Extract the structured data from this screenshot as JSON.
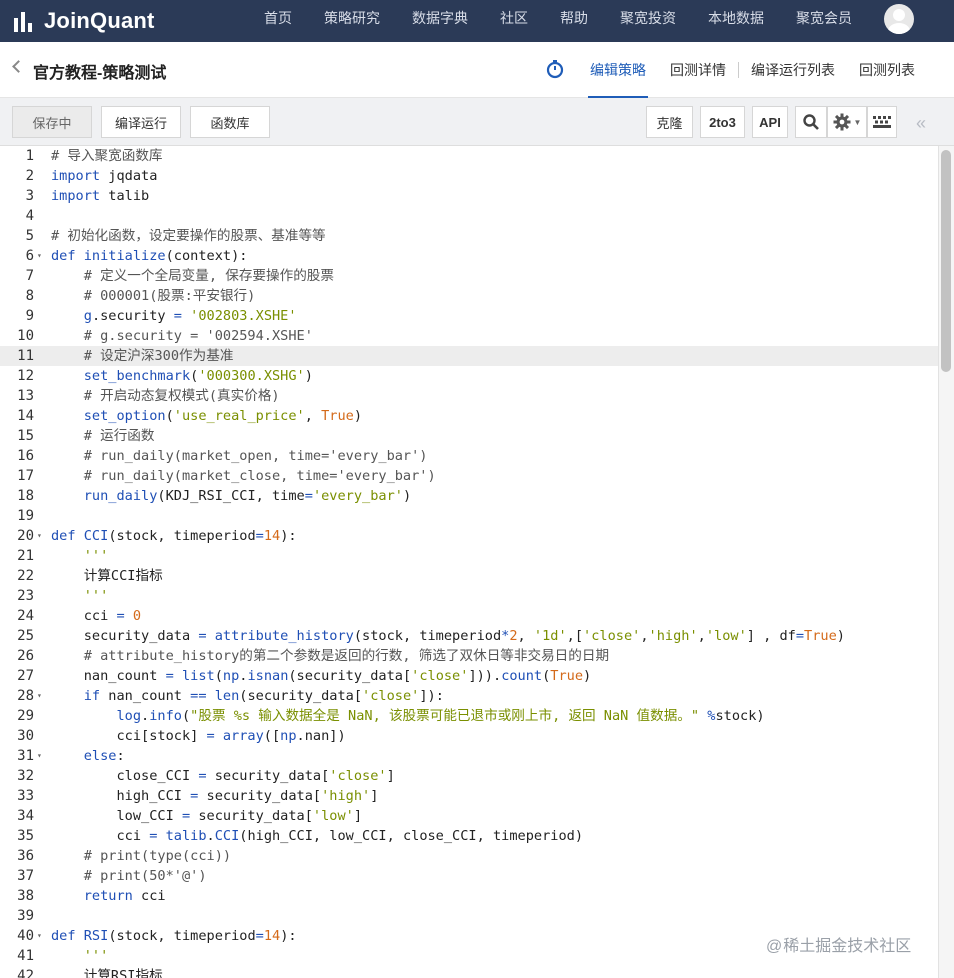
{
  "brand": {
    "name": "JoinQuant"
  },
  "nav": [
    "首页",
    "策略研究",
    "数据字典",
    "社区",
    "帮助",
    "聚宽投资",
    "本地数据",
    "聚宽会员"
  ],
  "titlebar": {
    "title": "官方教程-策略测试",
    "tabs": [
      "编辑策略",
      "回测详情",
      "编译运行列表",
      "回测列表"
    ]
  },
  "toolbar": {
    "save": "保存中",
    "compile": "编译运行",
    "library": "函数库",
    "clone": "克隆",
    "two_to_three": "2to3",
    "api": "API"
  },
  "editor": {
    "active_line": 11,
    "lines": [
      "# 导入聚宽函数库",
      "import jqdata",
      "import talib",
      "",
      "# 初始化函数，设定要操作的股票、基准等等",
      "def initialize(context):",
      "    # 定义一个全局变量, 保存要操作的股票",
      "    # 000001(股票:平安银行)",
      "    g.security = '002803.XSHE'",
      "    # g.security = '002594.XSHE'",
      "    # 设定沪深300作为基准",
      "    set_benchmark('000300.XSHG')",
      "    # 开启动态复权模式(真实价格)",
      "    set_option('use_real_price', True)",
      "    # 运行函数",
      "    # run_daily(market_open, time='every_bar')",
      "    # run_daily(market_close, time='every_bar')",
      "    run_daily(KDJ_RSI_CCI, time='every_bar')",
      "",
      "def CCI(stock, timeperiod=14):",
      "    '''",
      "    计算CCI指标",
      "    '''",
      "    cci = 0",
      "    security_data = attribute_history(stock, timeperiod*2, '1d',['close','high','low'] , df=True)",
      "    # attribute_history的第二个参数是返回的行数, 筛选了双休日等非交易日的日期",
      "    nan_count = list(np.isnan(security_data['close'])).count(True)",
      "    if nan_count == len(security_data['close']):",
      "        log.info(\"股票 %s 输入数据全是 NaN, 该股票可能已退市或刚上市, 返回 NaN 值数据。\" %stock)",
      "        cci[stock] = array([np.nan])",
      "    else:",
      "        close_CCI = security_data['close']",
      "        high_CCI = security_data['high']",
      "        low_CCI = security_data['low']",
      "        cci = talib.CCI(high_CCI, low_CCI, close_CCI, timeperiod)",
      "    # print(type(cci))",
      "    # print(50*'@')",
      "    return cci",
      "",
      "def RSI(stock, timeperiod=14):",
      "    '''",
      "    计算RSI指标"
    ],
    "fold_lines": [
      6,
      20,
      28,
      31,
      40
    ]
  },
  "watermark": "稀土掘金技术社区",
  "colors": {
    "nav_bg": "#2b3a57",
    "accent": "#1f5db8",
    "keyword": "#1f4fb5",
    "string": "#7a8f00",
    "number": "#d46a1a",
    "comment": "#555555",
    "function": "#1f4fb5"
  }
}
